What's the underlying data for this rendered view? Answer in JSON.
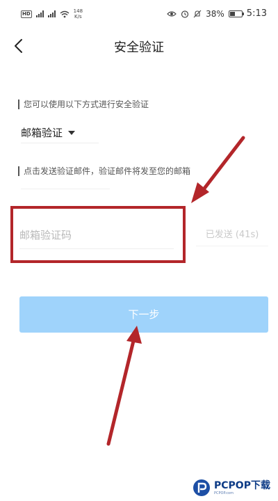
{
  "status_bar": {
    "network_badge": "HD",
    "signal_1": "3G",
    "signal_2": "4G",
    "net_speed_value": "148",
    "net_speed_unit": "K/s",
    "battery_percent": "38%",
    "battery_level": 0.38,
    "time": "5:13",
    "icons": [
      "eye-icon",
      "alarm-icon",
      "mute-icon",
      "battery-icon",
      "wifi-icon"
    ]
  },
  "header": {
    "title": "安全验证",
    "back_icon": "chevron-left-icon"
  },
  "form": {
    "method_hint": "您可以使用以下方式进行安全验证",
    "method_selected": "邮箱验证",
    "send_hint": "点击发送验证邮件，验证邮件将发至您的邮箱",
    "code_placeholder": "邮箱验证码",
    "resend_label": "已发送 (41s)",
    "next_label": "下一步"
  },
  "annotations": {
    "highlight_color": "#b3262a",
    "arrow_color": "#b3262a"
  },
  "colors": {
    "primary_button": "#9fd3fb",
    "text_primary": "#222222",
    "text_muted": "#c9c9c9"
  },
  "watermark": {
    "title": "PCPOP下载",
    "subtitle": "PCPOP.com"
  }
}
